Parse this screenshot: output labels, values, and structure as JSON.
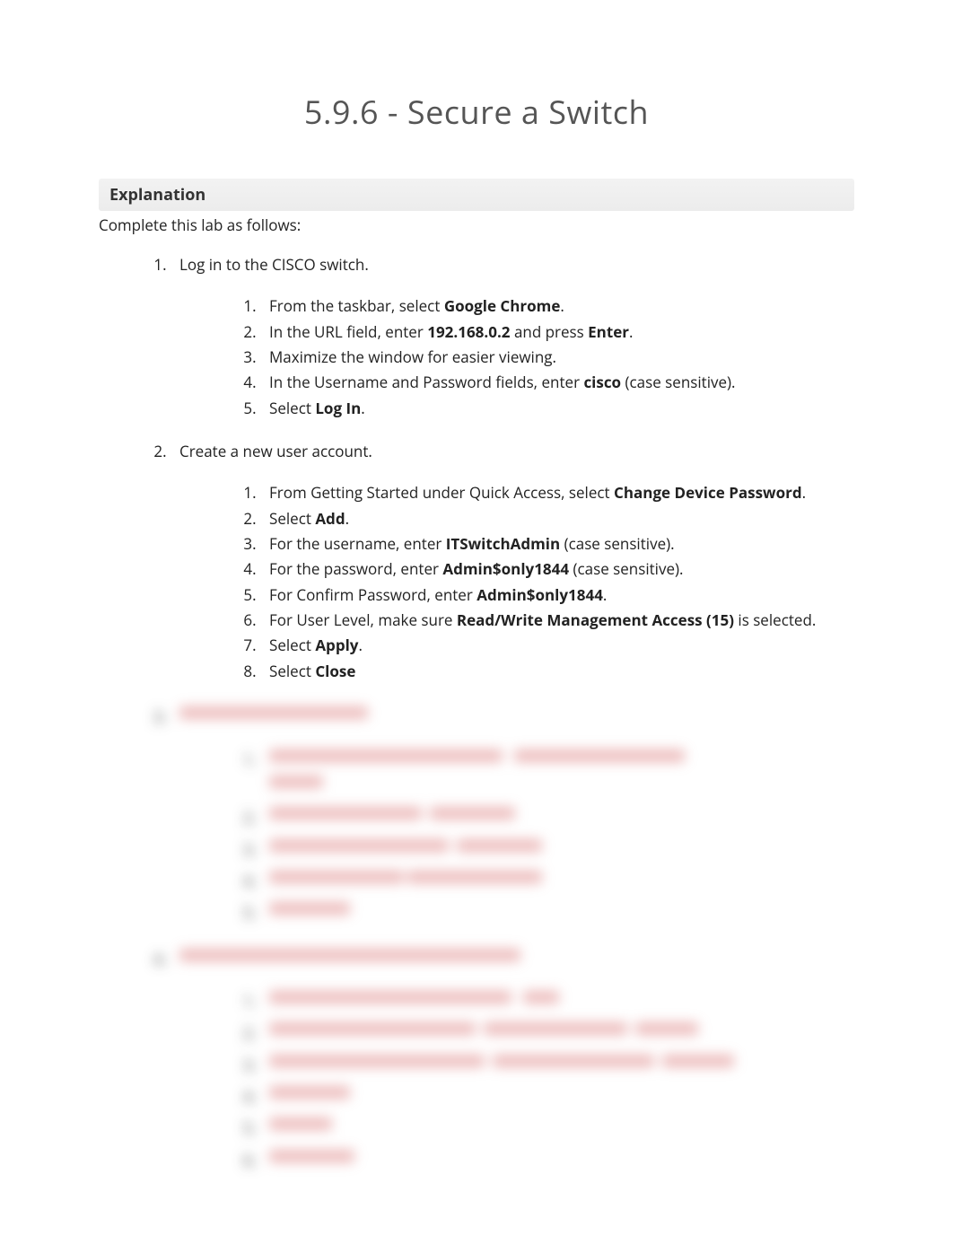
{
  "title": "5.9.6 - Secure a Switch",
  "explanationHeader": "Explanation",
  "intro": "Complete this lab as follows:",
  "steps": [
    {
      "label": "Log in to the CISCO switch.",
      "substeps": [
        {
          "prefix": "From the taskbar, select ",
          "bold": "Google Chrome",
          "suffix": "."
        },
        {
          "prefix": "In the URL field, enter ",
          "bold": "192.168.0.2",
          "mid": " and press ",
          "bold2": "Enter",
          "suffix": "."
        },
        {
          "prefix": "Maximize the window for easier viewing."
        },
        {
          "prefix": "In the Username and Password fields, enter ",
          "bold": "cisco",
          "suffix": " (case sensitive)."
        },
        {
          "prefix": "Select ",
          "bold": "Log In",
          "suffix": "."
        }
      ]
    },
    {
      "label": "Create a new user account.",
      "substeps": [
        {
          "prefix": "From Getting Started under Quick Access, select ",
          "bold": "Change Device Password",
          "suffix": "."
        },
        {
          "prefix": "Select ",
          "bold": "Add",
          "suffix": "."
        },
        {
          "prefix": "For the username, enter ",
          "bold": "ITSwitchAdmin",
          "suffix": " (case sensitive)."
        },
        {
          "prefix": "For the password, enter ",
          "bold": "Admin$only1844",
          "suffix": " (case sensitive)."
        },
        {
          "prefix": "For Confirm Password, enter ",
          "bold": "Admin$only1844",
          "suffix": "."
        },
        {
          "prefix": "For User Level, make sure ",
          "bold": "Read/Write Management Access (15)",
          "suffix": " is selected."
        },
        {
          "prefix": "Select ",
          "bold": "Apply",
          "suffix": "."
        },
        {
          "prefix": "Select ",
          "bold": "Close"
        }
      ]
    }
  ]
}
